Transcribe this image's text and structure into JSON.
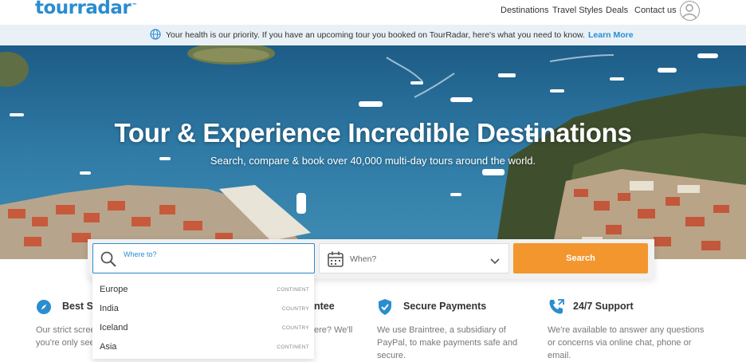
{
  "header": {
    "logo": "tourradar",
    "logo_tm": "™",
    "nav": [
      "Destinations",
      "Travel Styles",
      "Deals",
      "Contact us"
    ]
  },
  "banner": {
    "message": "Your health is our priority. If you have an upcoming tour you booked on TourRadar, here's what you need to know.",
    "link": "Learn More"
  },
  "hero": {
    "title": "Tour & Experience Incredible Destinations",
    "subtitle": "Search, compare & book over 40,000 multi-day tours around the world."
  },
  "search": {
    "where_placeholder": "Where to?",
    "when_label": "When?",
    "button": "Search"
  },
  "dropdown": [
    {
      "name": "Europe",
      "type": "CONTINENT"
    },
    {
      "name": "India",
      "type": "COUNTRY"
    },
    {
      "name": "Iceland",
      "type": "COUNTRY"
    },
    {
      "name": "Asia",
      "type": "CONTINENT"
    }
  ],
  "features": [
    {
      "title": "Best S",
      "text": [
        "Our strict scree",
        "you're only see"
      ]
    },
    {
      "title": "ntee",
      "text": [
        "ere? We'll",
        ""
      ]
    },
    {
      "title": "Secure Payments",
      "text": [
        "We use Braintree, a subsidiary of",
        "PayPal, to make payments safe and",
        "secure."
      ]
    },
    {
      "title": "24/7 Support",
      "text": [
        "We're available to answer any questions",
        "or concerns via online chat, phone or",
        "email."
      ]
    }
  ],
  "colors": {
    "brand_blue": "#2a8dcf",
    "search_orange": "#f3962e",
    "banner_bg": "#e9f1f7"
  }
}
